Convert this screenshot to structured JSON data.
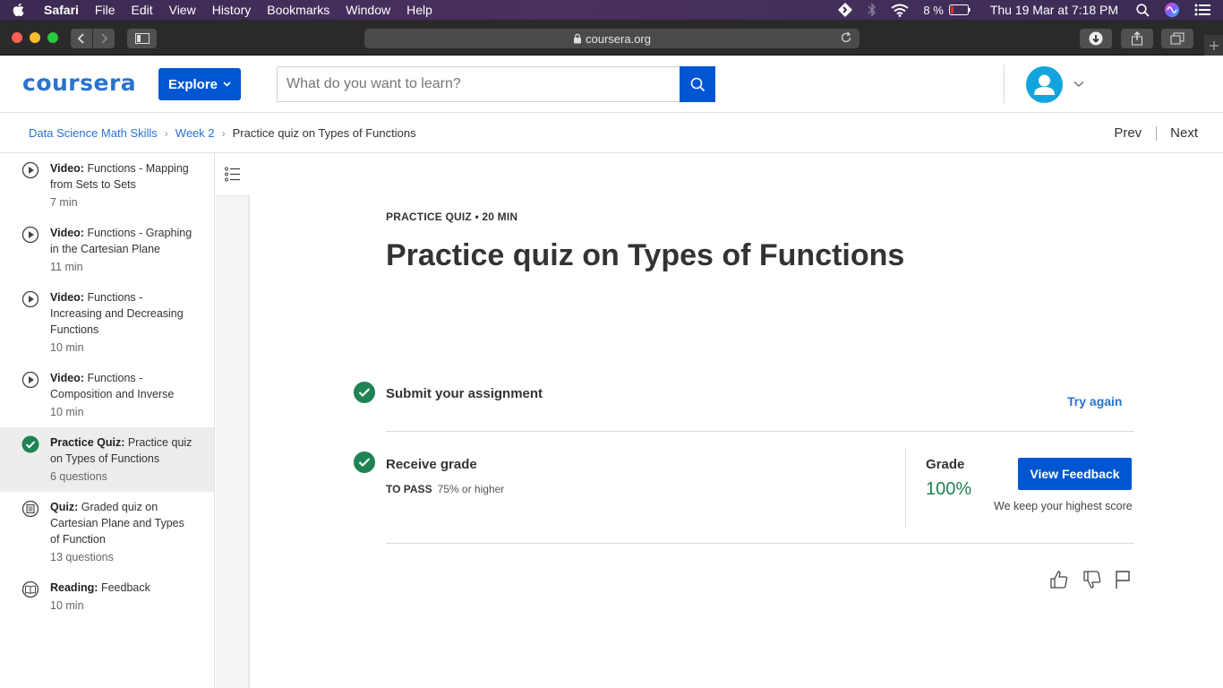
{
  "menubar": {
    "app": "Safari",
    "items": [
      "File",
      "Edit",
      "View",
      "History",
      "Bookmarks",
      "Window",
      "Help"
    ],
    "battery": "8 %",
    "datetime": "Thu 19 Mar at  7:18 PM"
  },
  "browser": {
    "url": "coursera.org"
  },
  "header": {
    "logo": "coursera",
    "explore_label": "Explore",
    "search_placeholder": "What do you want to learn?",
    "accent_color": "#0056d2"
  },
  "breadcrumb": {
    "items": [
      "Data Science Math Skills",
      "Week 2",
      "Practice quiz on Types of Functions"
    ],
    "prev": "Prev",
    "next": "Next"
  },
  "sidebar": {
    "items": [
      {
        "type": "Video:",
        "title": "Functions - Mapping from Sets to Sets",
        "meta": "7 min",
        "icon": "play-icon"
      },
      {
        "type": "Video:",
        "title": "Functions - Graphing in the Cartesian Plane",
        "meta": "11 min",
        "icon": "play-icon"
      },
      {
        "type": "Video:",
        "title": "Functions - Increasing and Decreasing Functions",
        "meta": "10 min",
        "icon": "play-icon"
      },
      {
        "type": "Video:",
        "title": "Functions - Composition and Inverse",
        "meta": "10 min",
        "icon": "play-icon"
      },
      {
        "type": "Practice Quiz:",
        "title": "Practice quiz on Types of Functions",
        "meta": "6 questions",
        "icon": "check-circle-icon",
        "active": true
      },
      {
        "type": "Quiz:",
        "title": "Graded quiz on Cartesian Plane and Types of Function",
        "meta": "13 questions",
        "icon": "quiz-icon"
      },
      {
        "type": "Reading:",
        "title": "Feedback",
        "meta": "10 min",
        "icon": "book-icon"
      }
    ]
  },
  "main": {
    "kicker": "PRACTICE QUIZ • 20 MIN",
    "title": "Practice quiz on Types of Functions",
    "step1_title": "Submit your assignment",
    "try_again": "Try again",
    "step2_title": "Receive grade",
    "to_pass_label": "TO PASS",
    "to_pass_value": "75% or higher",
    "grade_label": "Grade",
    "grade_value": "100%",
    "view_feedback": "View Feedback",
    "keep_note": "We keep your highest score",
    "success_color": "#1f8354"
  }
}
